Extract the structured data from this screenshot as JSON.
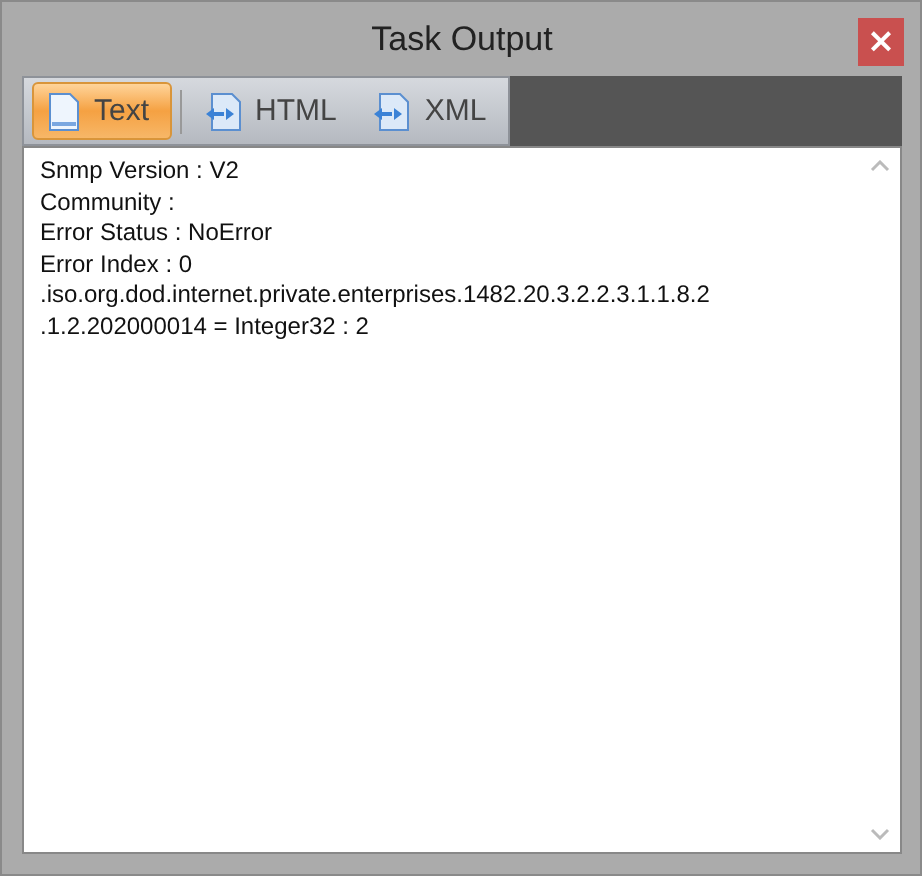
{
  "window": {
    "title": "Task Output",
    "close": "×"
  },
  "tabs": [
    {
      "label": "Text",
      "selected": true,
      "kind": "text"
    },
    {
      "label": "HTML",
      "selected": false,
      "kind": "markup"
    },
    {
      "label": "XML",
      "selected": false,
      "kind": "markup"
    }
  ],
  "output": {
    "lines": [
      "Snmp Version : V2",
      "Community :",
      "Error Status : NoError",
      "Error Index : 0",
      ".iso.org.dod.internet.private.enterprises.1482.20.3.2.2.3.1.1.8.2",
      ".1.2.202000014 = Integer32 : 2"
    ]
  }
}
